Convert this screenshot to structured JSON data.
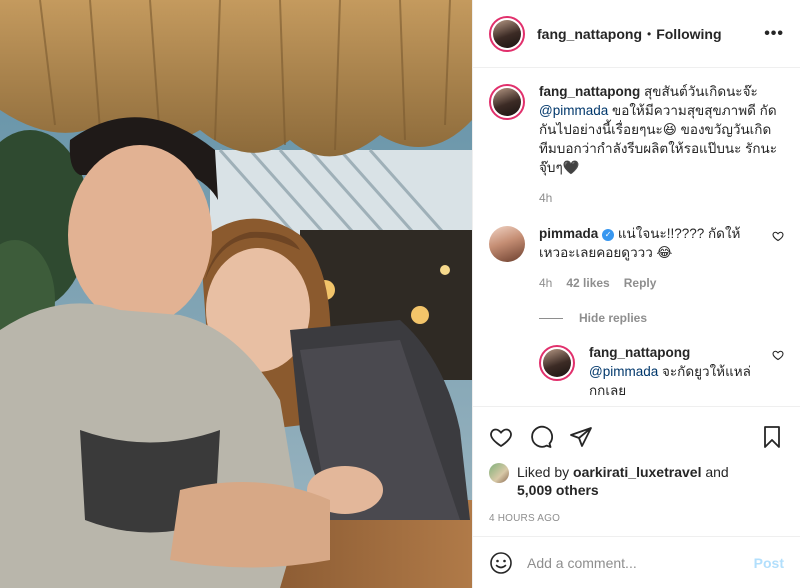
{
  "post": {
    "username": "fang_nattapong",
    "follow_status": "Following",
    "more_label": "•••"
  },
  "caption": {
    "username": "fang_nattapong",
    "text_before": "สุขสันต์วันเกิดนะจ๊ะ",
    "mention": "@pimmada",
    "text_after": "ขอให้มีความสุขสุขภาพดี กัดกันไปอย่างนี้เรื่อยๆนะ😆 ของขวัญวันเกิดทีมบอกว่ากำลังรีบผลิตให้รอแป๊บนะ รักนะจุ๊บๆ🖤",
    "time": "4h"
  },
  "comment": {
    "username": "pimmada",
    "text": "แน่ใจนะ!!???? กัดให้เหวอะเลยคอยดูววว 😂",
    "time": "4h",
    "likes": "42 likes",
    "reply_label": "Reply"
  },
  "hide_replies_label": "Hide replies",
  "reply": {
    "username": "fang_nattapong",
    "mention": "@pimmada",
    "text": "จะกัดยูวให้แหล่กกเลย"
  },
  "likes": {
    "prefix": "Liked by",
    "user": "oarkirati_luxetravel",
    "middle": "and",
    "others": "5,009 others"
  },
  "timestamp": "4 HOURS AGO",
  "add_comment": {
    "placeholder": "Add a comment...",
    "post_label": "Post"
  },
  "colors": {
    "mention": "#00376b",
    "verified": "#3897f0",
    "post_button": "#b2dffc",
    "story_ring": "#e1306c"
  },
  "icons": [
    "heart-icon",
    "comment-icon",
    "share-icon",
    "bookmark-icon",
    "emoji-icon",
    "verified-icon"
  ]
}
